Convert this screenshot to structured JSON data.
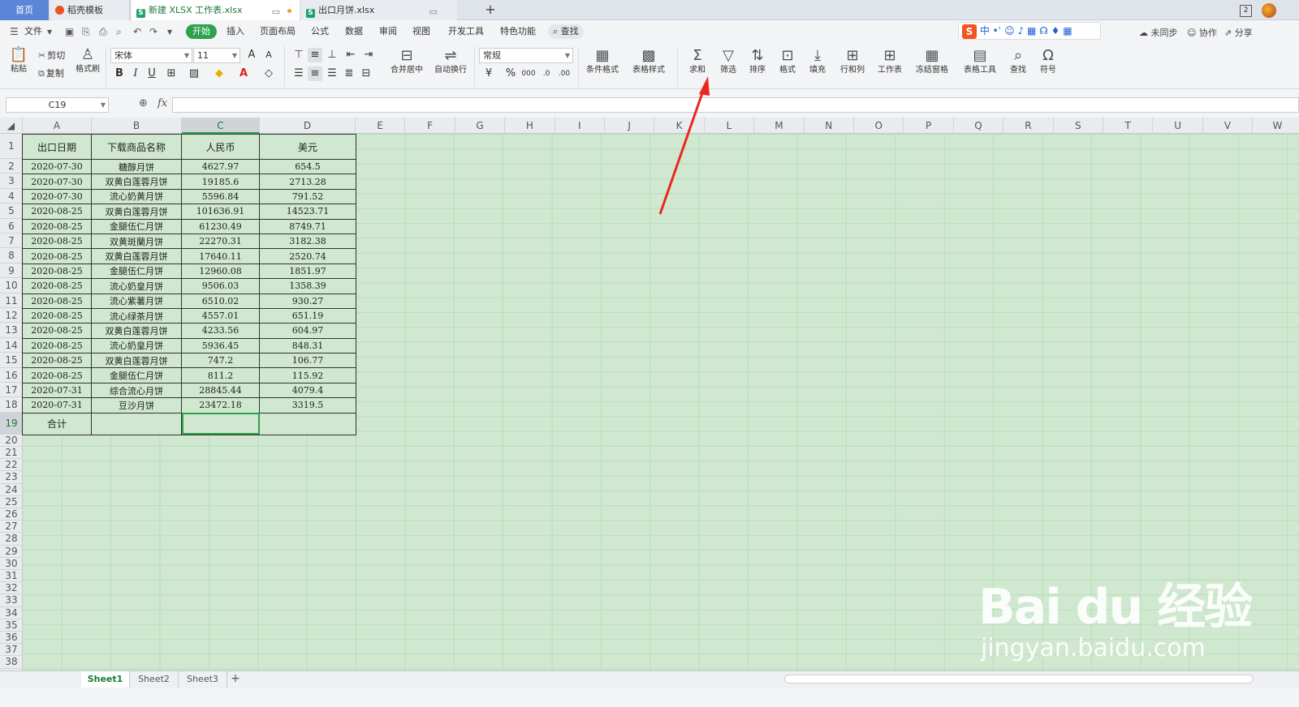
{
  "tabs": {
    "home": "首页",
    "docer": "稻壳模板",
    "active": "新建 XLSX 工作表.xlsx",
    "other": "出口月饼.xlsx",
    "icon_s": "S"
  },
  "titlebar": {
    "badge": "2"
  },
  "menu": {
    "file": "文件",
    "start": "开始",
    "insert": "插入",
    "page_layout": "页面布局",
    "formula": "公式",
    "data": "数据",
    "review": "审阅",
    "view": "视图",
    "developer": "开发工具",
    "special": "特色功能",
    "search": "查找",
    "unsynced": "未同步",
    "collaborate": "协作",
    "share": "分享"
  },
  "ime": {
    "logo": "S",
    "mode": "中"
  },
  "ribbon": {
    "paste": "粘贴",
    "cut": "剪切",
    "copy": "复制",
    "format_painter": "格式刷",
    "font_name": "宋体",
    "font_size": "11",
    "bold": "B",
    "italic": "I",
    "underline": "U",
    "merge_center": "合并居中",
    "wrap": "自动换行",
    "number_format": "常规",
    "currency": "¥",
    "percent": "%",
    "thousands": "000",
    "cond_format": "条件格式",
    "table_style": "表格样式",
    "sum": "求和",
    "filter": "筛选",
    "sort": "排序",
    "format": "格式",
    "fill": "填充",
    "row_col": "行和列",
    "worksheet": "工作表",
    "freeze": "冻结窗格",
    "table_tools": "表格工具",
    "find": "查找",
    "symbol": "符号"
  },
  "formula_bar": {
    "cell_ref": "C19",
    "fx": "fx",
    "value": ""
  },
  "columns": [
    "A",
    "B",
    "C",
    "D",
    "E",
    "F",
    "G",
    "H",
    "I",
    "J",
    "K",
    "L",
    "M",
    "N",
    "O",
    "P",
    "Q",
    "R",
    "S",
    "T",
    "U",
    "V",
    "W"
  ],
  "rows": [
    "1",
    "2",
    "3",
    "4",
    "5",
    "6",
    "7",
    "8",
    "9",
    "10",
    "11",
    "12",
    "13",
    "14",
    "15",
    "16",
    "17",
    "18",
    "19",
    "20",
    "21",
    "22",
    "23",
    "24",
    "25",
    "26",
    "27",
    "28",
    "29",
    "30",
    "31",
    "32",
    "33",
    "34",
    "35",
    "36",
    "37",
    "38"
  ],
  "table": {
    "headers": [
      "出口日期",
      "下载商品名称",
      "人民币",
      "美元"
    ],
    "rows": [
      [
        "2020-07-30",
        "糖醇月饼",
        "4627.97",
        "654.5"
      ],
      [
        "2020-07-30",
        "双黄白莲蓉月饼",
        "19185.6",
        "2713.28"
      ],
      [
        "2020-07-30",
        "流心奶黄月饼",
        "5596.84",
        "791.52"
      ],
      [
        "2020-08-25",
        "双黄白莲蓉月饼",
        "101636.91",
        "14523.71"
      ],
      [
        "2020-08-25",
        "金腿伍仁月饼",
        "61230.49",
        "8749.71"
      ],
      [
        "2020-08-25",
        "双黄斑蘭月饼",
        "22270.31",
        "3182.38"
      ],
      [
        "2020-08-25",
        "双黄白莲蓉月饼",
        "17640.11",
        "2520.74"
      ],
      [
        "2020-08-25",
        "金腿伍仁月饼",
        "12960.08",
        "1851.97"
      ],
      [
        "2020-08-25",
        "流心奶皇月饼",
        "9506.03",
        "1358.39"
      ],
      [
        "2020-08-25",
        "流心紫薯月饼",
        "6510.02",
        "930.27"
      ],
      [
        "2020-08-25",
        "流心绿茶月饼",
        "4557.01",
        "651.19"
      ],
      [
        "2020-08-25",
        "双黄白莲蓉月饼",
        "4233.56",
        "604.97"
      ],
      [
        "2020-08-25",
        "流心奶皇月饼",
        "5936.45",
        "848.31"
      ],
      [
        "2020-08-25",
        "双黄白莲蓉月饼",
        "747.2",
        "106.77"
      ],
      [
        "2020-08-25",
        "金腿伍仁月饼",
        "811.2",
        "115.92"
      ],
      [
        "2020-07-31",
        "综合流心月饼",
        "28845.44",
        "4079.4"
      ],
      [
        "2020-07-31",
        "豆沙月饼",
        "23472.18",
        "3319.5"
      ]
    ],
    "total_label": "合计"
  },
  "sheets": [
    "Sheet1",
    "Sheet2",
    "Sheet3"
  ],
  "watermark": {
    "line1": "Bai du 经验",
    "line2": "jingyan.baidu.com"
  },
  "colors": {
    "accent": "#2ea14f",
    "grid_bg": "#cfe8cf",
    "arrow": "#e8281e",
    "home_tab": "#5b86d8"
  }
}
